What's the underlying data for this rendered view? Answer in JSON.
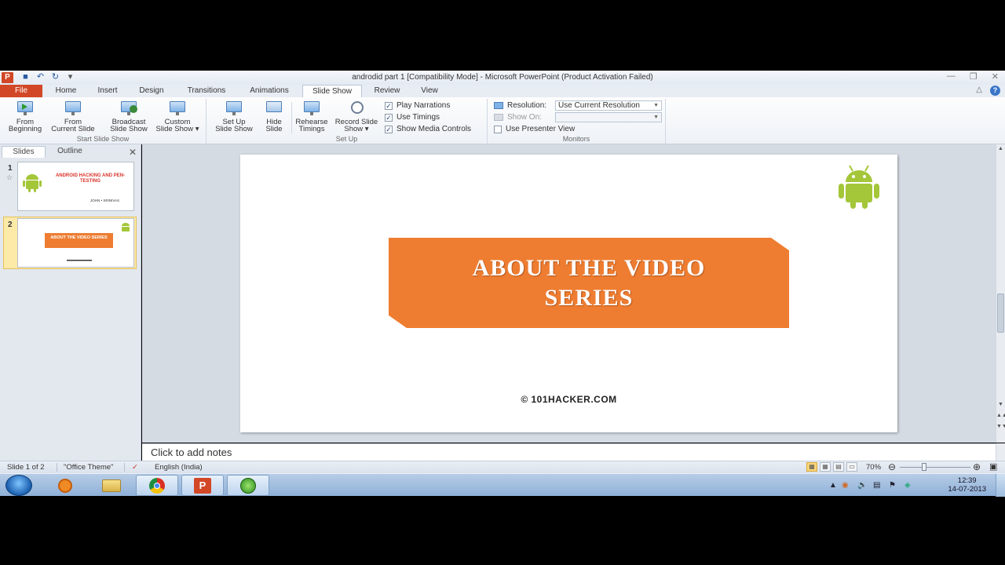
{
  "window": {
    "title": "androdid part 1 [Compatibility Mode] - Microsoft PowerPoint (Product Activation Failed)",
    "app_icon_letter": "P"
  },
  "ribbon_tabs": [
    "File",
    "Home",
    "Insert",
    "Design",
    "Transitions",
    "Animations",
    "Slide Show",
    "Review",
    "View"
  ],
  "active_tab": "Slide Show",
  "ribbon": {
    "groups": {
      "start": "Start Slide Show",
      "setup": "Set Up",
      "monitors": "Monitors"
    },
    "buttons": {
      "from_beginning_1": "From",
      "from_beginning_2": "Beginning",
      "from_current_1": "From",
      "from_current_2": "Current Slide",
      "broadcast_1": "Broadcast",
      "broadcast_2": "Slide Show",
      "custom_1": "Custom",
      "custom_2": "Slide Show ▾",
      "setup_1": "Set Up",
      "setup_2": "Slide Show",
      "hide_1": "Hide",
      "hide_2": "Slide",
      "rehearse_1": "Rehearse",
      "rehearse_2": "Timings",
      "record_1": "Record Slide",
      "record_2": "Show ▾"
    },
    "checkboxes": {
      "play_narrations": "Play Narrations",
      "use_timings": "Use Timings",
      "show_media_controls": "Show Media Controls",
      "use_presenter_view": "Use Presenter View"
    },
    "resolution_label": "Resolution:",
    "resolution_value": "Use Current Resolution",
    "show_on_label": "Show On:",
    "show_on_value": ""
  },
  "left_pane": {
    "tabs": [
      "Slides",
      "Outline"
    ],
    "active": "Slides",
    "slide_numbers": [
      "1",
      "2"
    ],
    "thumb1_title": "ANDROID HACKING AND PEN-TESTING",
    "thumb1_sub": "JOHN • SRINIVAS",
    "thumb2_title": "ABOUT THE VIDEO SERIES"
  },
  "slide": {
    "banner_line1": "ABOUT THE VIDEO",
    "banner_line2": "SERIES",
    "copyright": "©  101HACKER.COM",
    "brand_colors": {
      "banner": "#ee7d31",
      "android": "#a4c639"
    }
  },
  "notes_placeholder": "Click to add notes",
  "statusbar": {
    "slide_count": "Slide 1 of 2",
    "theme": "\"Office Theme\"",
    "language": "English (India)",
    "zoom": "70%"
  },
  "taskbar": {
    "time": "12:39",
    "date": "14-07-2013"
  }
}
